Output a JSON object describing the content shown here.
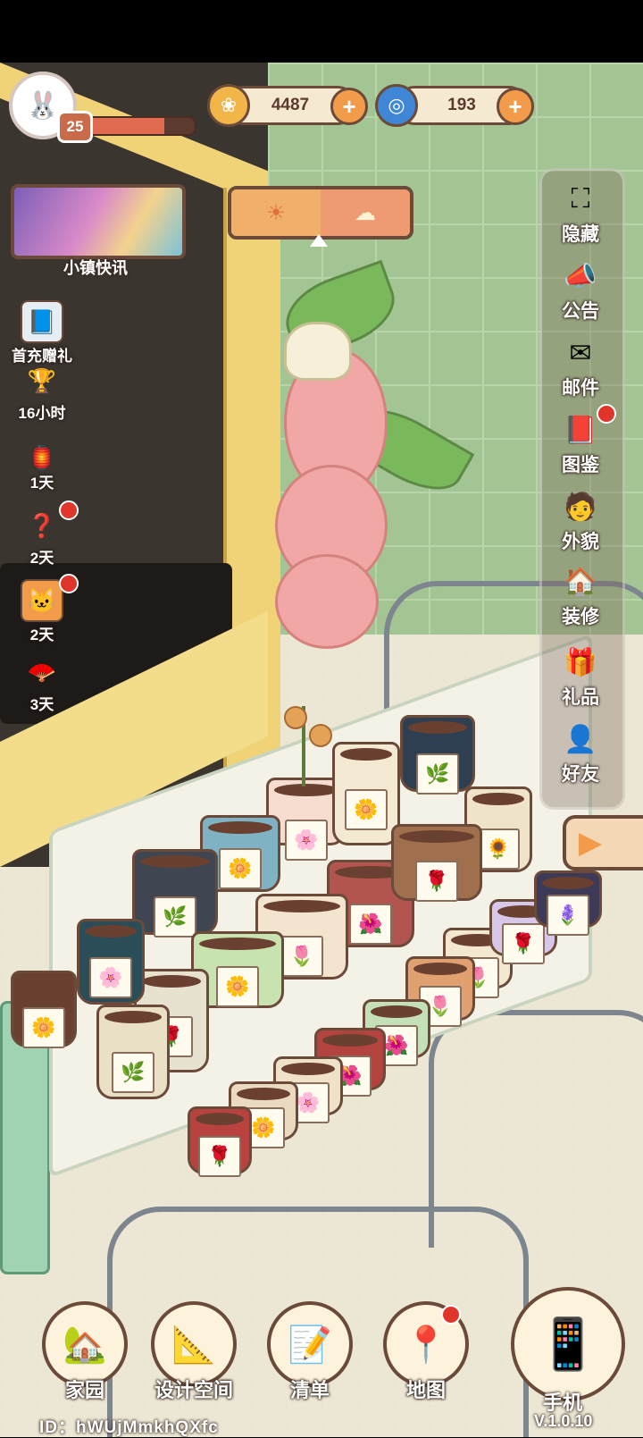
{
  "player": {
    "avatar_icon": "bunny-avatar-icon",
    "level": "25",
    "xp_fraction": 0.72
  },
  "resources": {
    "coins": {
      "icon": "coin-icon",
      "value": "4487"
    },
    "gems": {
      "icon": "swirl-gem-icon",
      "value": "193"
    }
  },
  "news": {
    "label": "小镇快讯"
  },
  "left_menu": [
    {
      "name": "first-charge-gift",
      "icon": "gift-book-icon",
      "label": "首充赠礼",
      "badge": false
    },
    {
      "name": "trophy-event",
      "icon": "trophy-icon",
      "label": "16小时",
      "badge": false
    },
    {
      "name": "lamp-event",
      "icon": "lamp-icon",
      "label": "1天",
      "badge": false
    },
    {
      "name": "question-event",
      "icon": "question-icon",
      "label": "2天",
      "badge": true
    },
    {
      "name": "cat-box-event",
      "icon": "cat-box-icon",
      "label": "2天",
      "badge": true
    },
    {
      "name": "fan-event",
      "icon": "fan-icon",
      "label": "3天",
      "badge": false
    }
  ],
  "right_menu": [
    {
      "name": "hide",
      "icon": "expand-frame-icon",
      "label": "隐藏",
      "badge": false
    },
    {
      "name": "announcement",
      "icon": "megaphone-icon",
      "label": "公告",
      "badge": false
    },
    {
      "name": "mail",
      "icon": "envelope-icon",
      "label": "邮件",
      "badge": false
    },
    {
      "name": "collection",
      "icon": "book-icon",
      "label": "图鉴",
      "badge": true
    },
    {
      "name": "appearance",
      "icon": "face-icon",
      "label": "外貌",
      "badge": false
    },
    {
      "name": "decorate",
      "icon": "house-wrench-icon",
      "label": "装修",
      "badge": false
    },
    {
      "name": "gifts",
      "icon": "gift-icon",
      "label": "礼品",
      "badge": false
    },
    {
      "name": "friends",
      "icon": "friend-icon",
      "label": "好友",
      "badge": false
    }
  ],
  "bottom_nav": [
    {
      "name": "home",
      "icon": "house-icon",
      "label": "家园",
      "badge": false
    },
    {
      "name": "design-space",
      "icon": "ruler-icon",
      "label": "设计空间",
      "badge": false
    },
    {
      "name": "list",
      "icon": "list-icon",
      "label": "清单",
      "badge": false
    },
    {
      "name": "map",
      "icon": "map-pin-icon",
      "label": "地图",
      "badge": true
    }
  ],
  "phone": {
    "icon": "phone-icon",
    "label": "手机",
    "version": "V.1.0.10"
  },
  "player_id": "ID：hWUjMmkhQXfc"
}
